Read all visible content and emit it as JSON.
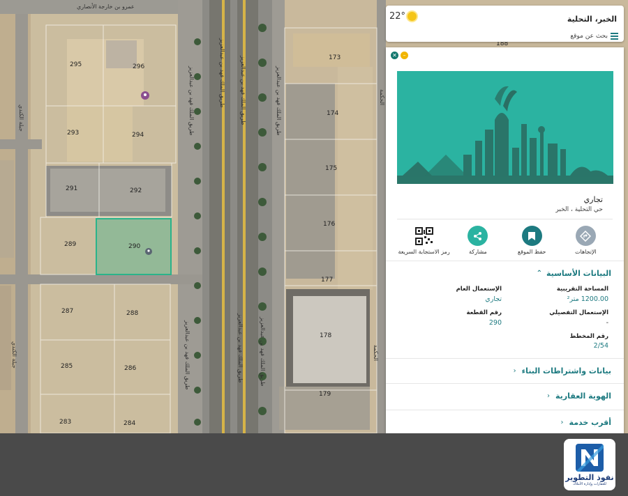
{
  "top_card": {
    "title": "الخبر، التحلية",
    "search_label": "بحث عن موقع",
    "temperature": "22°"
  },
  "panel": {
    "plot_type": "تجاري",
    "district": "حي التحلية ، الخبر",
    "actions": [
      {
        "label": "الإتجاهات",
        "icon": "directions-icon",
        "color": "#9aa8b5"
      },
      {
        "label": "حفظ الموقع",
        "icon": "bookmark-icon",
        "color": "#1d7a80"
      },
      {
        "label": "مشاركة",
        "icon": "share-icon",
        "color": "#2bb3a1"
      },
      {
        "label": "رمز الاستجابة السريعة",
        "icon": "qr-code-icon",
        "color": "#222222"
      }
    ],
    "basic_section": "البيانات الأساسية",
    "fields": {
      "approx_area_label": "المساحة التقريبية",
      "approx_area_value": "1200.00 متر²",
      "general_use_label": "الإستعمال العام",
      "general_use_value": "تجاري",
      "detailed_use_label": "الإستعمال التفصيلي",
      "detailed_use_value": "-",
      "plot_number_label": "رقم القطعة",
      "plot_number_value": "290",
      "plan_number_label": "رقم المخطط",
      "plan_number_value": "2/54"
    },
    "sections": [
      {
        "title": "بيانات واشتراطات البناء"
      },
      {
        "title": "الهوية العقارية"
      },
      {
        "title": "أقرب خدمة"
      }
    ]
  },
  "map": {
    "plots": [
      "295",
      "296",
      "293",
      "294",
      "291",
      "292",
      "289",
      "290",
      "287",
      "288",
      "285",
      "286",
      "283",
      "284",
      "173",
      "174",
      "175",
      "176",
      "177",
      "178",
      "179",
      "188"
    ],
    "roads": {
      "top_street": "عمرو بن خارجة الأنصاري",
      "king_fahd_1": "طريق الملك فهد بن عبدالعزيز",
      "king_fahd_2": "طريق الملك فهد بن عبدالعزيز",
      "king_fahd_3": "طريق الملك فهد بن عبدالعزيز",
      "king_fahd_4": "طريق الملك فهد بن عبدالعزيز",
      "king_fahd_5": "طريق الملك فهد بن عبدالعزيز",
      "king_fahd_6": "طريق الملك فهد بن عبدالعزيز",
      "king_fahd_7": "طريق الملك فهد بن عبدالعزيز",
      "side_1": "جبلة الكندي",
      "side_2": "جبلة الكندي",
      "side_3": "الحكمة",
      "side_4": "الحكمة"
    },
    "selected_plot_color": "#2bb38a"
  },
  "logo": {
    "name": "نفوذ التطوير",
    "tagline": "للعقارات وإدارة الأملاك"
  }
}
